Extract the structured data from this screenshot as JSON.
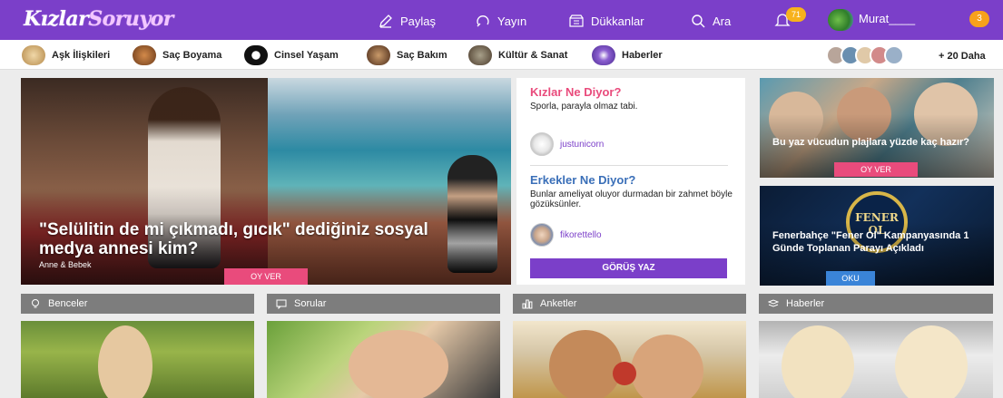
{
  "header": {
    "logo_main": "Kızlar",
    "logo_accent": "Soruyor",
    "nav": [
      {
        "label": "Paylaş",
        "icon": "pencil-icon"
      },
      {
        "label": "Yayın",
        "icon": "broadcast-icon"
      },
      {
        "label": "Dükkanlar",
        "icon": "store-icon"
      },
      {
        "label": "Ara",
        "icon": "search-icon"
      }
    ],
    "bell_count": "71",
    "username": "Murat____",
    "notif_count": "3",
    "colors": {
      "bar": "#7b3fc9",
      "badge": "#f7b21c"
    }
  },
  "categories": {
    "items": [
      {
        "label": "Aşk İlişkileri"
      },
      {
        "label": "Saç Boyama"
      },
      {
        "label": "Cinsel Yaşam"
      },
      {
        "label": "Saç Bakım"
      },
      {
        "label": "Kültür & Sanat"
      },
      {
        "label": "Haberler"
      }
    ],
    "more_label": "+ 20 Daha"
  },
  "hero": {
    "title": "\"Selülitin de mi çıkmadı, gıcık\" dediğiniz sosyal medya annesi kim?",
    "category": "Anne & Bebek",
    "button": "OY VER"
  },
  "opinions": {
    "girls_heading": "Kızlar Ne Diyor?",
    "girls_text": "Sporla, parayla olmaz tabi.",
    "girls_user": "justunicorn",
    "boys_heading": "Erkekler Ne Diyor?",
    "boys_text": "Bunlar ameliyat oluyor durmadan bir zahmet böyle gözüksünler.",
    "boys_user": "fikorettello",
    "button": "GÖRÜŞ YAZ"
  },
  "side_cards": [
    {
      "title": "Bu yaz vücudun plajlara yüzde kaç hazır?",
      "button": "OY VER"
    },
    {
      "title": "Fenerbahçe \"Fener Ol\" Kampanyasında 1 Günde Toplanan Parayı Açıkladı",
      "button": "OKU",
      "emblem": "FENER OL"
    }
  ],
  "sections": [
    {
      "label": "Benceler",
      "icon": "lightbulb-icon"
    },
    {
      "label": "Sorular",
      "icon": "chat-icon"
    },
    {
      "label": "Anketler",
      "icon": "bar-chart-icon"
    },
    {
      "label": "Haberler",
      "icon": "news-icon"
    }
  ]
}
